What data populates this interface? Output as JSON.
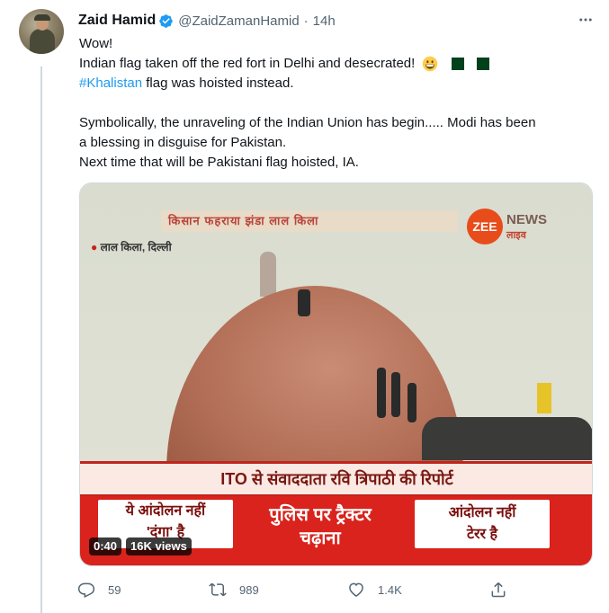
{
  "tweet": {
    "author_name": "Zaid Hamid",
    "handle": "@ZaidZamanHamid",
    "separator": "·",
    "time": "14h",
    "lines": {
      "l1": "Wow!",
      "l2": "Indian flag taken off the red fort in Delhi and desecrated!",
      "l3_hashtag": "#Khalistan",
      "l3_rest": " flag was hoisted instead.",
      "l4": "Symbolically, the unraveling of the Indian Union has begin..... Modi has been",
      "l5": "a blessing in disguise for Pakistan.",
      "l6": "Next time that will be Pakistani flag hoisted, IA."
    }
  },
  "video": {
    "duration": "0:40",
    "views": "16K views",
    "top_banner": "किसान फहराया झंडा लाल किला",
    "location": "लाल किला, दिल्ली",
    "channel_logo": "ZEE",
    "channel_name": "NEWS",
    "channel_live": "लाइव",
    "ticker": "ITO से संवाददाता रवि त्रिपाठी की रिपोर्ट",
    "lower_left_1": "ये आंदोलन नहीं",
    "lower_left_2": "'दंगा' है",
    "lower_center_1": "पुलिस पर ट्रैक्टर",
    "lower_center_2": "चढ़ाना",
    "lower_right_1": "आंदोलन नहीं",
    "lower_right_2": "टेरर है"
  },
  "actions": {
    "replies": "59",
    "retweets": "989",
    "likes": "1.4K"
  },
  "colors": {
    "link": "#1d9bf0",
    "muted": "#536471",
    "verified": "#1d9bf0"
  },
  "icons": [
    "verified-badge-icon",
    "more-icon",
    "grinning-emoji-icon",
    "pakistan-flag-icon",
    "reply-icon",
    "retweet-icon",
    "like-icon",
    "share-icon"
  ]
}
